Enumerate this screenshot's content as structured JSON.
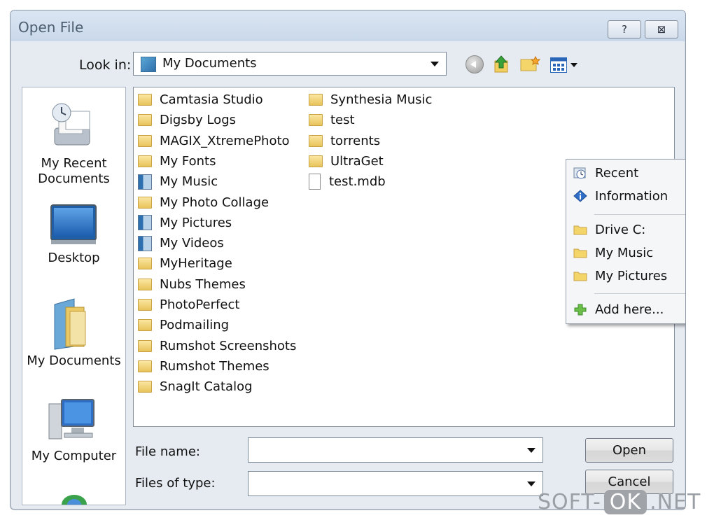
{
  "window": {
    "title": "Open File",
    "help_label": "?",
    "close_label": "⊠"
  },
  "toolbar": {
    "lookin_label": "Look in:",
    "lookin_value": "My Documents"
  },
  "places": [
    {
      "label": "My Recent\nDocuments",
      "icon": "recent-documents-icon"
    },
    {
      "label": "Desktop",
      "icon": "desktop-icon"
    },
    {
      "label": "My Documents",
      "icon": "my-documents-icon"
    },
    {
      "label": "My Computer",
      "icon": "my-computer-icon"
    }
  ],
  "files": [
    {
      "name": "Camtasia Studio",
      "type": "folder"
    },
    {
      "name": "Digsby Logs",
      "type": "folder"
    },
    {
      "name": "MAGIX_XtremePhoto",
      "type": "folder"
    },
    {
      "name": "My Fonts",
      "type": "folder"
    },
    {
      "name": "My Music",
      "type": "special-folder"
    },
    {
      "name": "My Photo Collage",
      "type": "folder"
    },
    {
      "name": "My Pictures",
      "type": "special-folder"
    },
    {
      "name": "My Videos",
      "type": "special-folder"
    },
    {
      "name": "MyHeritage",
      "type": "folder"
    },
    {
      "name": "Nubs Themes",
      "type": "folder"
    },
    {
      "name": "PhotoPerfect",
      "type": "folder"
    },
    {
      "name": "Podmailing",
      "type": "folder"
    },
    {
      "name": "Rumshot Screenshots",
      "type": "folder"
    },
    {
      "name": "Rumshot Themes",
      "type": "folder"
    },
    {
      "name": "SnagIt Catalog",
      "type": "folder"
    },
    {
      "name": "Synthesia Music",
      "type": "folder"
    },
    {
      "name": "test",
      "type": "folder"
    },
    {
      "name": "torrents",
      "type": "folder"
    },
    {
      "name": "UltraGet",
      "type": "folder"
    },
    {
      "name": "test.mdb",
      "type": "file"
    }
  ],
  "context_menu": {
    "items": [
      {
        "label": "Recent",
        "icon": "clock-icon",
        "submenu": true
      },
      {
        "label": "Information",
        "icon": "info-icon",
        "submenu": true
      },
      {
        "label": "Drive C:",
        "icon": "folder-icon",
        "submenu": false
      },
      {
        "label": "My Music",
        "icon": "folder-icon",
        "submenu": false
      },
      {
        "label": "My Pictures",
        "icon": "folder-icon",
        "submenu": false
      },
      {
        "label": "Add here...",
        "icon": "plus-icon",
        "submenu": false
      }
    ]
  },
  "form": {
    "filename_label": "File name:",
    "filename_value": "",
    "filetype_label": "Files of type:",
    "filetype_value": "",
    "open_label": "Open",
    "cancel_label": "Cancel"
  },
  "watermark": {
    "left": "SOFT-",
    "mid": "OK",
    "right": ".NET"
  }
}
